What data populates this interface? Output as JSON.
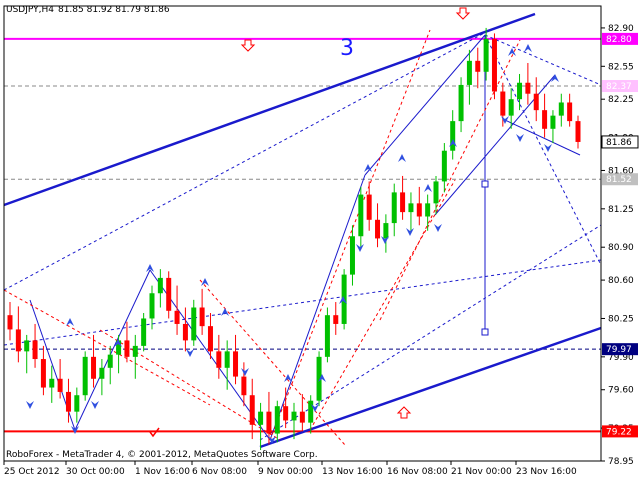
{
  "header": {
    "symbol_tf": "USDJPY,H4",
    "ohlc": "81.85 81.92 81.79 81.86"
  },
  "footer": {
    "copyright": "RoboForex - MetaTrader 4, © 2001-2012, MetaQuotes Software Corp."
  },
  "annotations": {
    "wave_label": "3"
  },
  "colors": {
    "candle_up": "#00c000",
    "candle_down": "#ff0000",
    "trend": "#1a1acc",
    "level_magenta": "#ff00ff",
    "level_red": "#ff0000",
    "level_navy": "#000080",
    "grid": "#c0c0c0"
  },
  "chart_data": {
    "type": "candlestick",
    "ylim": [
      78.95,
      83.1
    ],
    "y_ticks": [
      "82.90",
      "82.55",
      "82.25",
      "81.90",
      "81.60",
      "81.25",
      "80.90",
      "80.60",
      "80.25",
      "79.90",
      "79.60",
      "79.25",
      "78.95"
    ],
    "x_ticks": [
      "25 Oct 2012",
      "30 Oct 00:00",
      "1 Nov 16:00",
      "6 Nov 08:00",
      "9 Nov 00:00",
      "13 Nov 16:00",
      "16 Nov 08:00",
      "21 Nov 00:00",
      "23 Nov 16:00"
    ],
    "current_price": "81.86",
    "level_boxes": [
      {
        "label": "82.80",
        "value": 82.8,
        "color": "#ff00ff"
      },
      {
        "label": "82.37",
        "value": 82.37,
        "color": "#ffc0ff"
      },
      {
        "label": "81.52",
        "value": 81.52,
        "color": "#c0c0c0"
      },
      {
        "label": "79.97",
        "value": 79.97,
        "color": "#000080"
      },
      {
        "label": "79.22",
        "value": 79.22,
        "color": "#ff0000"
      }
    ],
    "candles": [
      [
        80.28,
        80.4,
        80.05,
        80.15
      ],
      [
        80.15,
        80.36,
        79.85,
        79.95
      ],
      [
        79.95,
        80.1,
        79.75,
        80.05
      ],
      [
        80.05,
        80.2,
        79.8,
        79.88
      ],
      [
        79.88,
        80.0,
        79.55,
        79.62
      ],
      [
        79.62,
        79.82,
        79.48,
        79.7
      ],
      [
        79.7,
        79.88,
        79.52,
        79.58
      ],
      [
        79.58,
        79.7,
        79.3,
        79.4
      ],
      [
        79.4,
        79.62,
        79.3,
        79.55
      ],
      [
        79.55,
        79.95,
        79.5,
        79.9
      ],
      [
        79.9,
        80.1,
        79.62,
        79.7
      ],
      [
        79.7,
        79.88,
        79.55,
        79.8
      ],
      [
        79.8,
        80.0,
        79.65,
        79.92
      ],
      [
        79.92,
        80.1,
        79.75,
        80.05
      ],
      [
        80.05,
        80.22,
        79.85,
        79.9
      ],
      [
        79.9,
        80.1,
        79.7,
        80.0
      ],
      [
        80.0,
        80.3,
        79.95,
        80.25
      ],
      [
        80.25,
        80.55,
        80.15,
        80.48
      ],
      [
        80.48,
        80.7,
        80.35,
        80.62
      ],
      [
        80.62,
        80.68,
        80.25,
        80.32
      ],
      [
        80.32,
        80.55,
        80.1,
        80.2
      ],
      [
        80.2,
        80.35,
        79.95,
        80.05
      ],
      [
        80.05,
        80.42,
        80.0,
        80.35
      ],
      [
        80.35,
        80.52,
        80.1,
        80.18
      ],
      [
        80.18,
        80.3,
        79.88,
        79.95
      ],
      [
        79.95,
        80.1,
        79.7,
        79.8
      ],
      [
        79.8,
        80.05,
        79.6,
        79.95
      ],
      [
        79.95,
        80.1,
        79.65,
        79.72
      ],
      [
        79.72,
        79.85,
        79.45,
        79.55
      ],
      [
        79.55,
        79.7,
        79.15,
        79.28
      ],
      [
        79.28,
        79.48,
        79.05,
        79.4
      ],
      [
        79.4,
        79.58,
        79.1,
        79.2
      ],
      [
        79.2,
        79.5,
        79.12,
        79.45
      ],
      [
        79.45,
        79.62,
        79.25,
        79.32
      ],
      [
        79.32,
        79.48,
        79.15,
        79.4
      ],
      [
        79.4,
        79.56,
        79.22,
        79.3
      ],
      [
        79.3,
        79.55,
        79.2,
        79.5
      ],
      [
        79.5,
        79.95,
        79.45,
        79.9
      ],
      [
        79.9,
        80.35,
        79.85,
        80.28
      ],
      [
        80.28,
        80.4,
        80.1,
        80.2
      ],
      [
        80.2,
        80.7,
        80.15,
        80.65
      ],
      [
        80.65,
        81.1,
        80.55,
        81.0
      ],
      [
        81.0,
        81.45,
        80.9,
        81.38
      ],
      [
        81.38,
        81.5,
        81.05,
        81.15
      ],
      [
        81.15,
        81.3,
        80.9,
        80.98
      ],
      [
        80.98,
        81.2,
        80.85,
        81.12
      ],
      [
        81.12,
        81.48,
        81.0,
        81.4
      ],
      [
        81.4,
        81.55,
        81.15,
        81.22
      ],
      [
        81.22,
        81.4,
        81.05,
        81.3
      ],
      [
        81.3,
        81.45,
        81.1,
        81.18
      ],
      [
        81.18,
        81.38,
        81.05,
        81.3
      ],
      [
        81.3,
        81.55,
        81.2,
        81.5
      ],
      [
        81.5,
        81.85,
        81.4,
        81.78
      ],
      [
        81.78,
        82.15,
        81.7,
        82.05
      ],
      [
        82.05,
        82.45,
        81.95,
        82.38
      ],
      [
        82.38,
        82.7,
        82.2,
        82.6
      ],
      [
        82.6,
        82.72,
        82.35,
        82.5
      ],
      [
        82.5,
        82.9,
        82.42,
        82.8
      ],
      [
        82.8,
        82.85,
        82.25,
        82.32
      ],
      [
        82.32,
        82.4,
        82.0,
        82.1
      ],
      [
        82.1,
        82.35,
        81.98,
        82.25
      ],
      [
        82.25,
        82.48,
        82.15,
        82.4
      ],
      [
        82.4,
        82.58,
        82.2,
        82.3
      ],
      [
        82.3,
        82.45,
        82.05,
        82.15
      ],
      [
        82.15,
        82.3,
        81.9,
        81.98
      ],
      [
        81.98,
        82.15,
        81.85,
        82.1
      ],
      [
        82.1,
        82.3,
        82.0,
        82.22
      ],
      [
        82.22,
        82.3,
        82.0,
        82.05
      ],
      [
        82.05,
        82.1,
        81.8,
        81.86
      ]
    ]
  }
}
